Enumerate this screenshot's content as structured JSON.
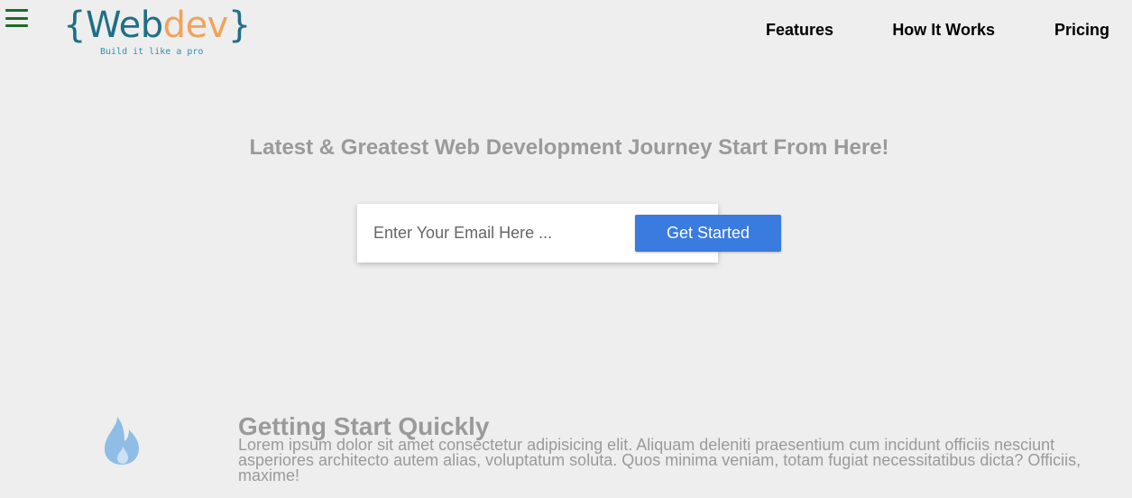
{
  "menu": {
    "icon": "hamburger-menu-icon"
  },
  "logo": {
    "brace_open": "{",
    "web": "Web",
    "dev": "dev",
    "brace_close": "}",
    "tagline": "Build it like a pro",
    "colors": {
      "web": "#1f6f86",
      "dev": "#f0a35a"
    }
  },
  "nav": {
    "items": [
      {
        "label": "Features"
      },
      {
        "label": "How It Works"
      },
      {
        "label": "Pricing"
      }
    ]
  },
  "hero": {
    "title": "Latest & Greatest Web Development Journey Start From Here!",
    "email_placeholder": "Enter Your Email Here ...",
    "email_value": "",
    "cta_label": "Get Started",
    "cta_color": "#3a7be0"
  },
  "feature": {
    "icon": "fire-icon",
    "icon_color": "#8fbde6",
    "title": "Getting Start Quickly",
    "text": "Lorem ipsum dolor sit amet consectetur adipisicing elit. Aliquam deleniti praesentium cum incidunt officiis nesciunt asperiores architecto autem alias, voluptatum soluta. Quos minima veniam, totam fugiat necessitatibus dicta? Officiis, maxime!"
  }
}
